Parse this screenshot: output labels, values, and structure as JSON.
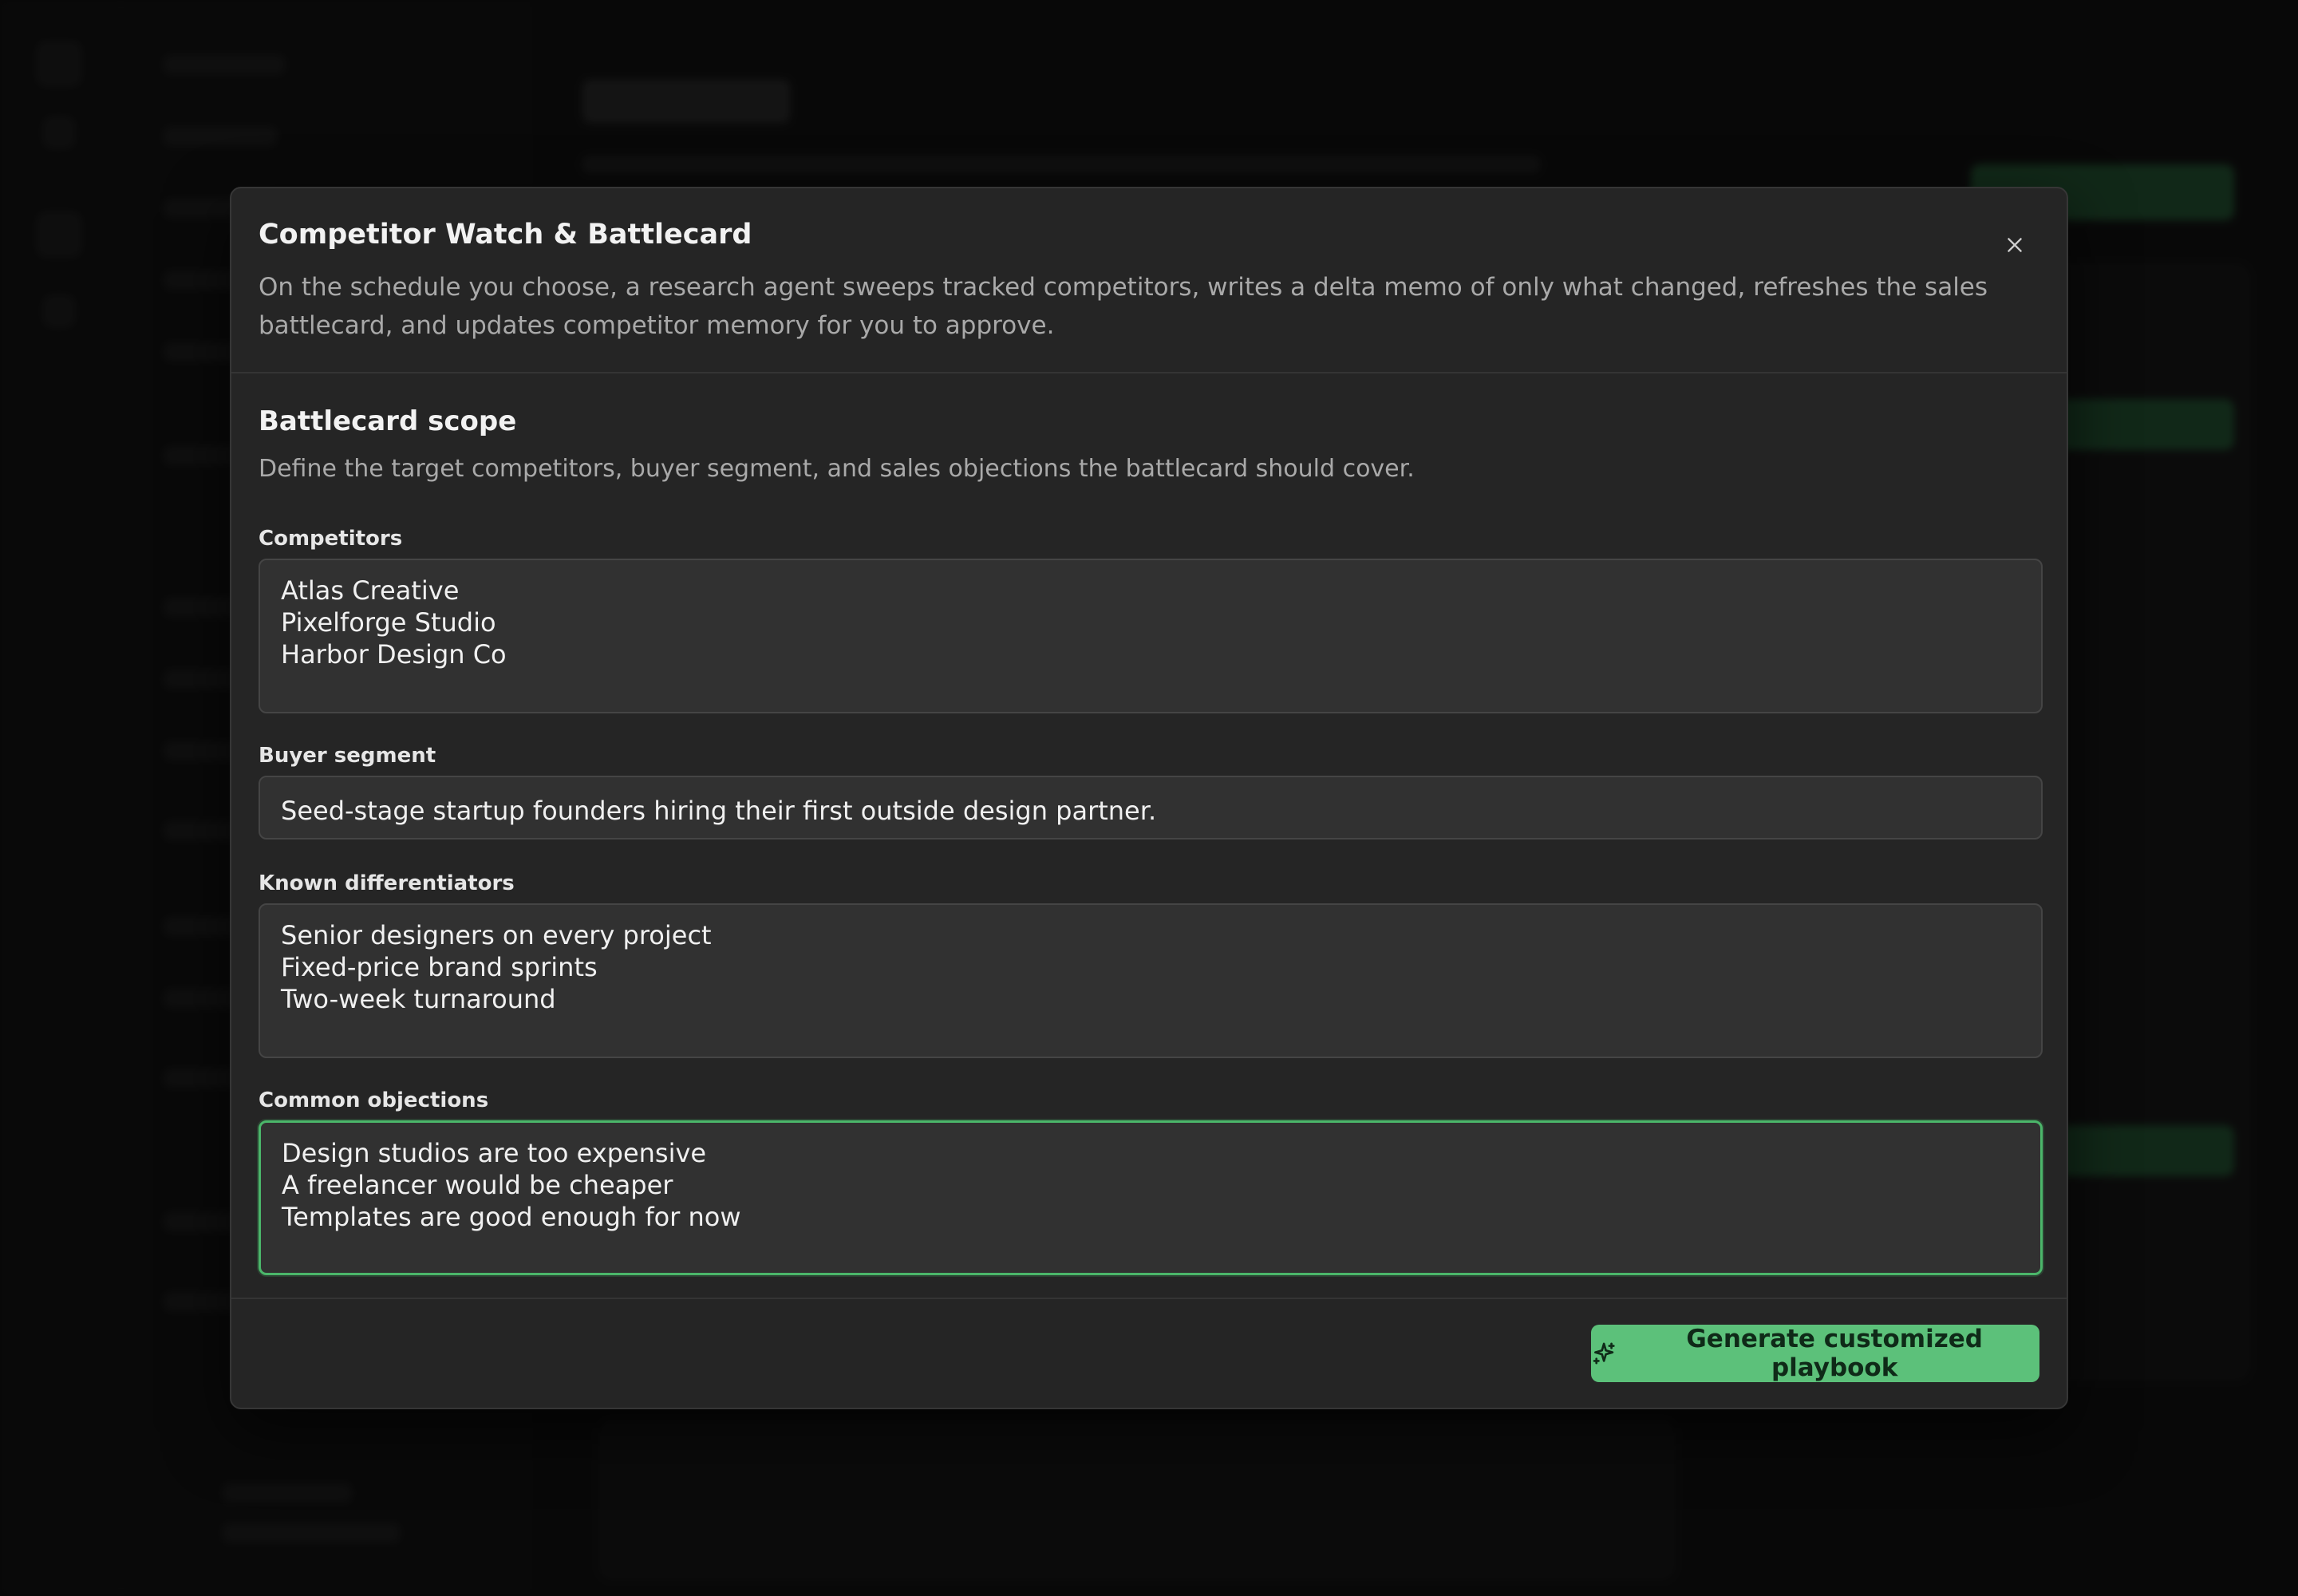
{
  "modal": {
    "title": "Competitor Watch & Battlecard",
    "description": "On the schedule you choose, a research agent sweeps tracked competitors, writes a delta memo of only what changed, refreshes the sales battlecard, and updates competitor memory for you to approve.",
    "close_icon": "close-icon"
  },
  "section": {
    "title": "Battlecard scope",
    "description": "Define the target competitors, buyer segment, and sales objections the battlecard should cover."
  },
  "fields": {
    "competitors": {
      "label": "Competitors",
      "value": "Atlas Creative\nPixelforge Studio\nHarbor Design Co"
    },
    "buyer_segment": {
      "label": "Buyer segment",
      "value": "Seed-stage startup founders hiring their first outside design partner."
    },
    "differentiators": {
      "label": "Known differentiators",
      "value": "Senior designers on every project\nFixed-price brand sprints\nTwo-week turnaround"
    },
    "objections": {
      "label": "Common objections",
      "value": "Design studios are too expensive\nA freelancer would be cheaper\nTemplates are good enough for now"
    }
  },
  "footer": {
    "generate_label": "Generate customized playbook",
    "generate_icon": "sparkles-icon"
  },
  "colors": {
    "accent": "#5cc17a",
    "focus_border": "#4bb66a",
    "modal_bg": "#252525",
    "field_bg": "#313131"
  }
}
